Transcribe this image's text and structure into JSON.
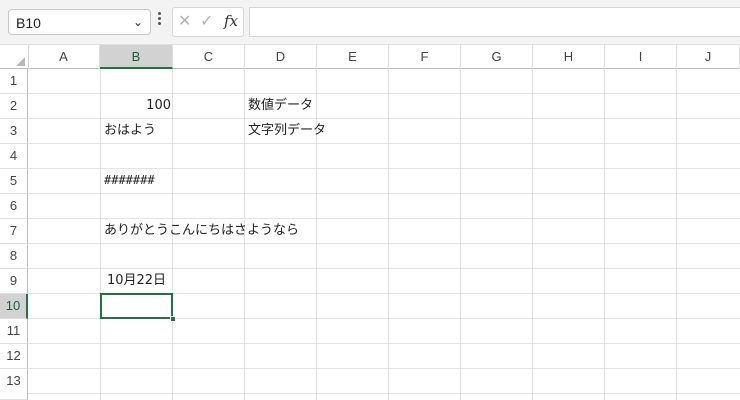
{
  "formula_bar": {
    "name_box": "B10",
    "function_label": "fx",
    "formula_value": ""
  },
  "columns": [
    "A",
    "B",
    "C",
    "D",
    "E",
    "F",
    "G",
    "H",
    "I",
    "J"
  ],
  "rows": [
    "1",
    "2",
    "3",
    "4",
    "5",
    "6",
    "7",
    "8",
    "9",
    "10",
    "11",
    "12",
    "13"
  ],
  "active_cell": {
    "column": "B",
    "row": "10"
  },
  "cells": {
    "b2": "100",
    "d2": "数値データ",
    "b3": "おはよう",
    "d3": "文字列データ",
    "b5": "#######",
    "b7": "ありがとうこんにちはさようなら",
    "b9": "10月22日"
  },
  "colors": {
    "accent": "#217346",
    "gridline": "#e3e3e3",
    "header_active_bg": "#d2d2d2"
  }
}
